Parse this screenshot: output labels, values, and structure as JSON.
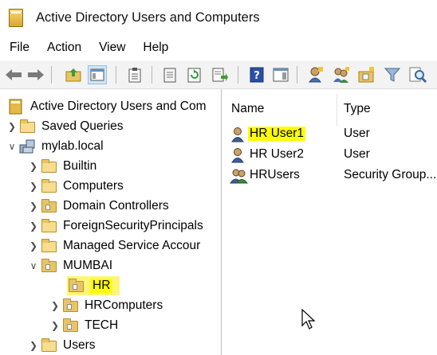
{
  "window": {
    "title": "Active Directory Users and Computers",
    "icon": "aduc-book-icon"
  },
  "menu": {
    "items": [
      "File",
      "Action",
      "View",
      "Help"
    ]
  },
  "toolbar": {
    "buttons": [
      "back-arrow-icon",
      "forward-arrow-icon",
      "up-folder-icon",
      "show-hide-console-tree-icon",
      "clipboard-icon",
      "properties-icon",
      "refresh-icon",
      "export-list-icon",
      "help-icon",
      "action-pane-icon",
      "new-user-icon",
      "new-group-icon",
      "new-ou-icon",
      "filter-icon",
      "find-icon"
    ]
  },
  "tree": {
    "root": "Active Directory Users and Com",
    "saved_queries": "Saved Queries",
    "domain": "mylab.local",
    "builtin": "Builtin",
    "computers": "Computers",
    "domain_controllers": "Domain Controllers",
    "foreign": "ForeignSecurityPrincipals",
    "managed": "Managed Service Accour",
    "mumbai": "MUMBAI",
    "hr": "HR",
    "hrcomputers": "HRComputers",
    "tech": "TECH",
    "users": "Users"
  },
  "list": {
    "columns": {
      "name": "Name",
      "type": "Type"
    },
    "rows": [
      {
        "name": "HR User1",
        "type": "User",
        "icon": "user-icon",
        "highlighted": true
      },
      {
        "name": "HR User2",
        "type": "User",
        "icon": "user-icon",
        "highlighted": false
      },
      {
        "name": "HRUsers",
        "type": "Security Group...",
        "icon": "group-icon",
        "highlighted": false
      }
    ]
  },
  "colors": {
    "highlight": "#ffff00",
    "toolbar_bg": "#f3f3f3",
    "folder": "#e8c564"
  }
}
